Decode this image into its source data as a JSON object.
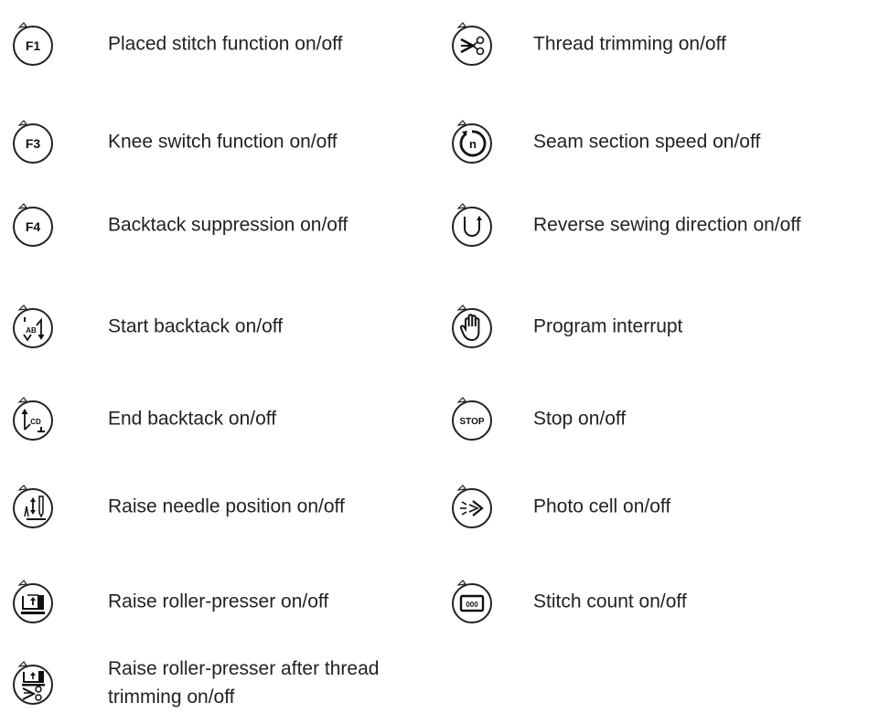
{
  "left_column": [
    {
      "icon": "f1-key-icon",
      "text": "F1",
      "label": "Placed stitch function on/off"
    },
    {
      "icon": "f3-key-icon",
      "text": "F3",
      "label": "Knee switch function on/off"
    },
    {
      "icon": "f4-key-icon",
      "text": "F4",
      "label": "Backtack suppression on/off"
    },
    {
      "icon": "start-backtack-icon",
      "text": "AB",
      "label": "Start backtack on/off"
    },
    {
      "icon": "end-backtack-icon",
      "text": "CD",
      "label": "End backtack on/off"
    },
    {
      "icon": "raise-needle-icon",
      "text": "",
      "label": "Raise needle position on/off"
    },
    {
      "icon": "raise-roller-presser-icon",
      "text": "",
      "label": "Raise roller-presser on/off"
    },
    {
      "icon": "raise-presser-after-trim-icon",
      "text": "",
      "label": "Raise roller-presser after thread trimming on/off"
    }
  ],
  "right_column": [
    {
      "icon": "thread-trimming-icon",
      "text": "",
      "label": "Thread trimming on/off"
    },
    {
      "icon": "seam-section-speed-icon",
      "text": "n",
      "label": "Seam section speed on/off"
    },
    {
      "icon": "reverse-direction-icon",
      "text": "",
      "label": "Reverse sewing direction on/off"
    },
    {
      "icon": "program-interrupt-icon",
      "text": "",
      "label": "Program interrupt"
    },
    {
      "icon": "stop-icon",
      "text": "STOP",
      "label": "Stop on/off"
    },
    {
      "icon": "photo-cell-icon",
      "text": "",
      "label": "Photo cell on/off"
    },
    {
      "icon": "stitch-count-icon",
      "text": "000",
      "label": "Stitch count on/off"
    }
  ]
}
